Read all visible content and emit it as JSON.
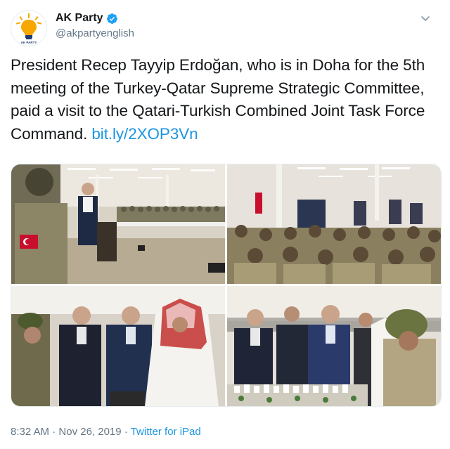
{
  "author": {
    "display_name": "AK Party",
    "handle": "@akpartyenglish",
    "avatar_text": "AK PARTY",
    "verified_icon": "verified-badge-icon"
  },
  "tweet": {
    "text": "President Recep Tayyip Erdoğan, who is in Doha for the 5th meeting of the Turkey-Qatar Supreme Strategic Committee, paid a visit to the Qatari-Turkish Combined Joint Task Force Command. ",
    "link": "bit.ly/2XOP3Vn"
  },
  "media": {
    "photos": [
      {
        "name": "photo-podium-speech"
      },
      {
        "name": "photo-troops-audience"
      },
      {
        "name": "photo-ceremony-button"
      },
      {
        "name": "photo-model-viewing"
      }
    ]
  },
  "meta": {
    "time": "8:32 AM",
    "separator": " · ",
    "date": "Nov 26, 2019",
    "source": "Twitter for iPad"
  },
  "colors": {
    "link": "#1b95e0",
    "secondary_text": "#657786",
    "verified": "#1da1f2"
  }
}
